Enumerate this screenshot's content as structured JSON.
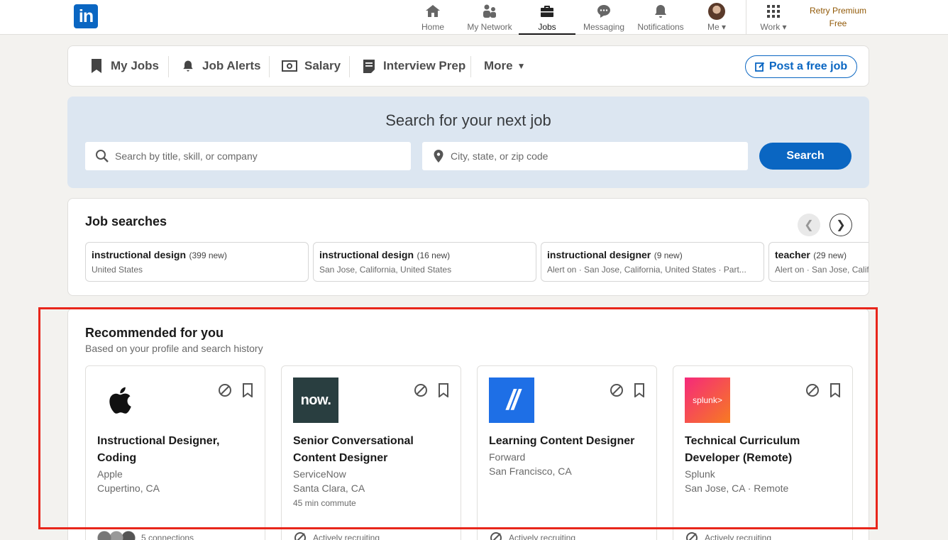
{
  "nav": {
    "logo": "in",
    "items": [
      {
        "label": "Home",
        "icon": "home-icon"
      },
      {
        "label": "My Network",
        "icon": "network-icon"
      },
      {
        "label": "Jobs",
        "icon": "briefcase-icon"
      },
      {
        "label": "Messaging",
        "icon": "messaging-icon"
      },
      {
        "label": "Notifications",
        "icon": "bell-icon"
      },
      {
        "label": "Me",
        "icon": "avatar"
      },
      {
        "label": "Work",
        "icon": "grid-icon"
      }
    ],
    "premium_line1": "Retry Premium",
    "premium_line2": "Free"
  },
  "subnav": {
    "items": [
      "My Jobs",
      "Job Alerts",
      "Salary",
      "Interview Prep",
      "More"
    ],
    "post_job": "Post a free job"
  },
  "hero": {
    "title": "Search for your next job",
    "keyword_placeholder": "Search by title, skill, or company",
    "location_placeholder": "City, state, or zip code",
    "search_label": "Search"
  },
  "job_searches": {
    "title": "Job searches",
    "prev": "❮",
    "next": "❯",
    "items": [
      {
        "query": "instructional design",
        "new": "(399 new)",
        "location": "United States"
      },
      {
        "query": "instructional design",
        "new": "(16 new)",
        "location": "San Jose, California, United States"
      },
      {
        "query": "instructional designer",
        "new": "(9 new)",
        "location": "Alert on · San Jose, California, United States · Part..."
      },
      {
        "query": "teacher",
        "new": "(29 new)",
        "location": "Alert on · San Jose, California, United States"
      }
    ]
  },
  "recommended": {
    "title": "Recommended for you",
    "subtitle": "Based on your profile and search history",
    "jobs": [
      {
        "title": "Instructional Designer, Coding",
        "company": "Apple",
        "location": "Cupertino, CA",
        "extra": "",
        "logo_text": "",
        "footer": "5 connections"
      },
      {
        "title": "Senior Conversational Content Designer",
        "company": "ServiceNow",
        "location": "Santa Clara, CA",
        "extra": "45 min commute",
        "logo_text": "now.",
        "footer": "Actively recruiting"
      },
      {
        "title": "Learning Content Designer",
        "company": "Forward",
        "location": "San Francisco, CA",
        "extra": "",
        "logo_text": "//",
        "footer": "Actively recruiting"
      },
      {
        "title": "Technical Curriculum Developer (Remote)",
        "company": "Splunk",
        "location": "San Jose, CA · Remote",
        "extra": "",
        "logo_text": "splunk>",
        "footer": "Actively recruiting"
      }
    ]
  },
  "colors": {
    "brand": "#0a66c2",
    "highlight": "#e8261b",
    "premium": "#915907",
    "servicenow_bg": "#293e40",
    "forward_bg": "#1e6fe6",
    "splunk_from": "#f5297b",
    "splunk_to": "#f77b21"
  }
}
